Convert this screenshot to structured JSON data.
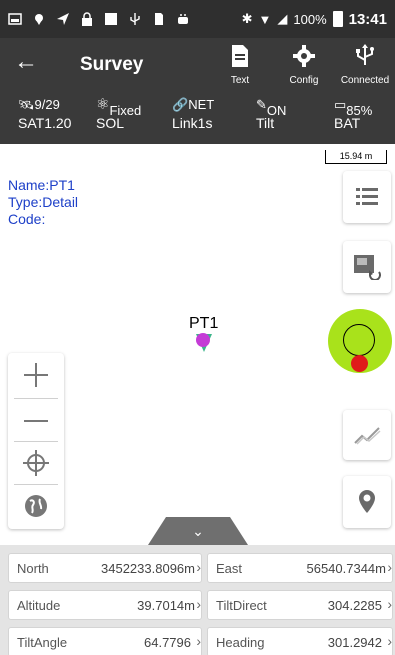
{
  "statusbar": {
    "battery_pct": "100%",
    "time": "13:41"
  },
  "toolbar": {
    "title": "Survey",
    "text_label": "Text",
    "config_label": "Config",
    "connected_label": "Connected"
  },
  "status_row": {
    "sat_top": "9/29",
    "sat_sub": "SAT1.20",
    "sol_top": "Fixed",
    "sol_sub": "SOL",
    "net_top": "NET",
    "net_sub": "Link1s",
    "tilt_top": "ON",
    "tilt_sub": "Tilt",
    "bat_top": "85%",
    "bat_sub": "BAT"
  },
  "map": {
    "scale_label": "15.94 m",
    "name_line": "Name:PT1",
    "type_line": "Type:Detail",
    "code_line": "Code:",
    "point_label": "PT1"
  },
  "data": {
    "north_label": "North",
    "north_value": "3452233.8096m",
    "east_label": "East",
    "east_value": "56540.7344m",
    "altitude_label": "Altitude",
    "altitude_value": "39.7014m",
    "tiltdirect_label": "TiltDirect",
    "tiltdirect_value": "304.2285",
    "tiltangle_label": "TiltAngle",
    "tiltangle_value": "64.7796",
    "heading_label": "Heading",
    "heading_value": "301.2942"
  },
  "colors": {
    "toolbar_bg": "#3a3a3a",
    "info_text": "#1e40c8",
    "bubble": "#a9e21b",
    "bubble_dot": "#e01a1a"
  }
}
